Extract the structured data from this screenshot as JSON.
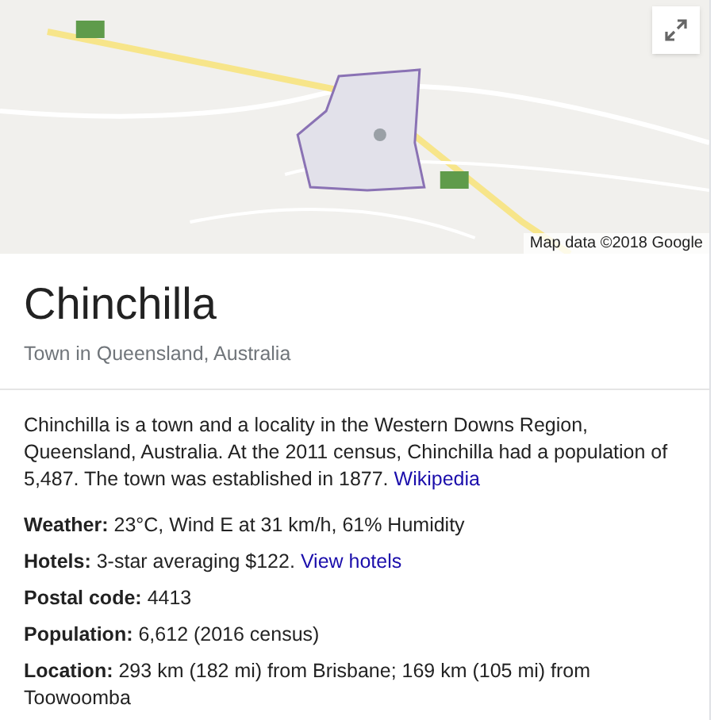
{
  "map": {
    "kind": "picture",
    "attribution": "Map data ©2018 Google"
  },
  "title": "Chinchilla",
  "subtitle": "Town in Queensland, Australia",
  "description": {
    "text": "Chinchilla is a town and a locality in the Western Downs Region, Queensland, Australia. At the 2011 census, Chinchilla had a population of 5,487. The town was established in 1877.",
    "link": "Wikipedia"
  },
  "facts": [
    {
      "label": "Weather:",
      "value": "23°C, Wind E at 31 km/h, 61% Humidity"
    },
    {
      "label": "Hotels:",
      "value": "3-star averaging $122.",
      "link": "View hotels"
    },
    {
      "label": "Postal code:",
      "value": "4413"
    },
    {
      "label": "Population:",
      "value": "6,612 (2016 census)"
    },
    {
      "label": "Location:",
      "value": "293 km (182 mi) from Brisbane; 169 km (105 mi) from Toowoomba"
    }
  ]
}
